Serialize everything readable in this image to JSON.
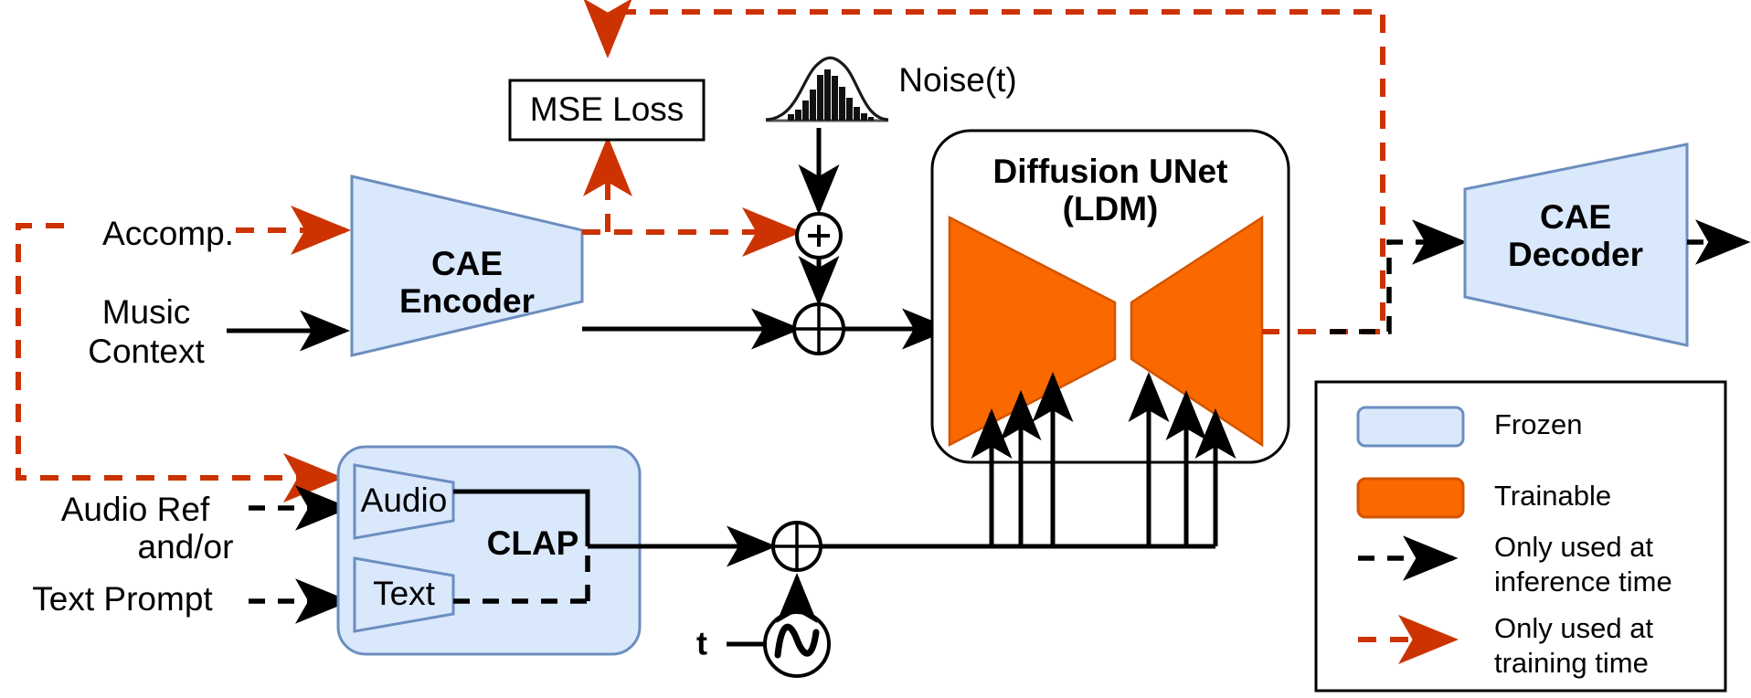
{
  "figure": {
    "title_semantic": "audio-diffusion-model-architecture"
  },
  "inputs": {
    "accomp": "Accomp.",
    "music_context_line1": "Music",
    "music_context_line2": "Context",
    "audio_ref": "Audio Ref",
    "andor": "and/or",
    "text_prompt": "Text Prompt"
  },
  "blocks": {
    "cae_encoder_line1": "CAE",
    "cae_encoder_line2": "Encoder",
    "mse_loss": "MSE Loss",
    "noise": "Noise(t)",
    "unet_line1": "Diffusion UNet",
    "unet_line2": "(LDM)",
    "cae_decoder_line1": "CAE",
    "cae_decoder_line2": "Decoder",
    "clap": "CLAP",
    "clap_audio": "Audio",
    "clap_text": "Text",
    "timestep": "t"
  },
  "operators": {
    "plus": "+",
    "oplus": "oplus-icon",
    "sinusoid": "sinusoidal-embedding-icon"
  },
  "legend": {
    "items": [
      {
        "label": "Frozen",
        "kind": "swatch",
        "color": "#dae8fc"
      },
      {
        "label": "Trainable",
        "kind": "swatch",
        "color": "#fa6800"
      },
      {
        "label": "Only used at\ninference time",
        "line1": "Only used at",
        "line2": "inference time",
        "kind": "dashed-arrow",
        "color": "#000000"
      },
      {
        "label": "Only used at\ntraining time",
        "line1": "Only used at",
        "line2": "training time",
        "kind": "dashed-arrow",
        "color": "#cc3300"
      }
    ]
  },
  "colors": {
    "frozen_fill": "#dae8fc",
    "frozen_stroke": "#6c8ebf",
    "trainable_fill": "#fa6800",
    "trainable_stroke": "#d35400",
    "training_arrow": "#cc3300",
    "inference_arrow": "#000000",
    "background": "#ffffff"
  }
}
